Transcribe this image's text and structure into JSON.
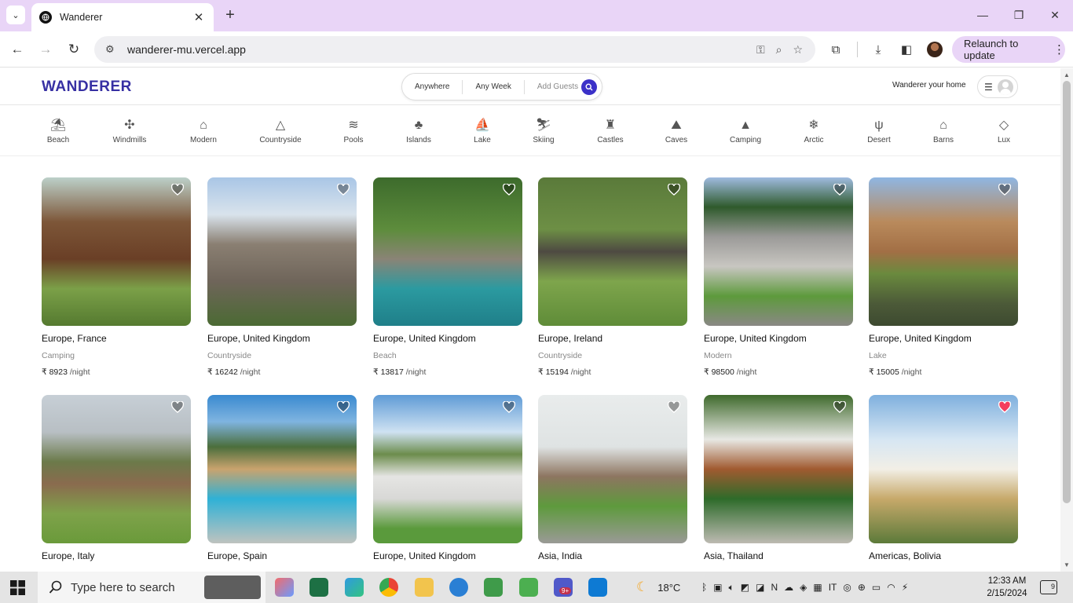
{
  "browser": {
    "tab_title": "Wanderer",
    "url": "wanderer-mu.vercel.app",
    "relaunch_label": "Relaunch to update"
  },
  "site": {
    "logo_text": "WANDERER",
    "search": {
      "anywhere": "Anywhere",
      "any_week": "Any Week",
      "add_guests": "Add Guests"
    },
    "host_link": "Wanderer your home"
  },
  "categories": [
    {
      "label": "Beach",
      "icon": "beach-icon",
      "glyph": "⛱"
    },
    {
      "label": "Windmills",
      "icon": "windmill-icon",
      "glyph": "✣"
    },
    {
      "label": "Modern",
      "icon": "modern-icon",
      "glyph": "⌂"
    },
    {
      "label": "Countryside",
      "icon": "mountain-icon",
      "glyph": "△"
    },
    {
      "label": "Pools",
      "icon": "pool-icon",
      "glyph": "≋"
    },
    {
      "label": "Islands",
      "icon": "island-icon",
      "glyph": "♣"
    },
    {
      "label": "Lake",
      "icon": "boat-icon",
      "glyph": "⛵"
    },
    {
      "label": "Skiing",
      "icon": "skiing-icon",
      "glyph": "⛷"
    },
    {
      "label": "Castles",
      "icon": "castle-icon",
      "glyph": "♜"
    },
    {
      "label": "Caves",
      "icon": "cave-icon",
      "glyph": "⛰"
    },
    {
      "label": "Camping",
      "icon": "camping-icon",
      "glyph": "▲"
    },
    {
      "label": "Arctic",
      "icon": "snowflake-icon",
      "glyph": "❄"
    },
    {
      "label": "Desert",
      "icon": "cactus-icon",
      "glyph": "ψ"
    },
    {
      "label": "Barns",
      "icon": "barn-icon",
      "glyph": "⌂"
    },
    {
      "label": "Lux",
      "icon": "diamond-icon",
      "glyph": "◇"
    }
  ],
  "listings": [
    {
      "location": "Europe, France",
      "category": "Camping",
      "price": "₹ 8923",
      "per": "/night",
      "liked": false
    },
    {
      "location": "Europe, United Kingdom",
      "category": "Countryside",
      "price": "₹ 16242",
      "per": "/night",
      "liked": false
    },
    {
      "location": "Europe, United Kingdom",
      "category": "Beach",
      "price": "₹ 13817",
      "per": "/night",
      "liked": false
    },
    {
      "location": "Europe, Ireland",
      "category": "Countryside",
      "price": "₹ 15194",
      "per": "/night",
      "liked": false
    },
    {
      "location": "Europe, United Kingdom",
      "category": "Modern",
      "price": "₹ 98500",
      "per": "/night",
      "liked": false
    },
    {
      "location": "Europe, United Kingdom",
      "category": "Lake",
      "price": "₹ 15005",
      "per": "/night",
      "liked": false
    },
    {
      "location": "Europe, Italy",
      "category": "",
      "price": "",
      "per": "",
      "liked": false
    },
    {
      "location": "Europe, Spain",
      "category": "",
      "price": "",
      "per": "",
      "liked": false
    },
    {
      "location": "Europe, United Kingdom",
      "category": "",
      "price": "",
      "per": "",
      "liked": false
    },
    {
      "location": "Asia, India",
      "category": "",
      "price": "",
      "per": "",
      "liked": false
    },
    {
      "location": "Asia, Thailand",
      "category": "",
      "price": "",
      "per": "",
      "liked": false
    },
    {
      "location": "Americas, Bolivia",
      "category": "",
      "price": "",
      "per": "",
      "liked": true
    }
  ],
  "taskbar": {
    "search_placeholder": "Type here to search",
    "weather": "18°C",
    "time": "12:33 AM",
    "date": "2/15/2024",
    "notifications": "9",
    "teams_badge": "9+"
  },
  "colors": {
    "brand": "#3730a3",
    "search_button": "#3b31c8",
    "liked_heart": "#f43f5e",
    "chrome_tabbar": "#e9d5f7"
  }
}
